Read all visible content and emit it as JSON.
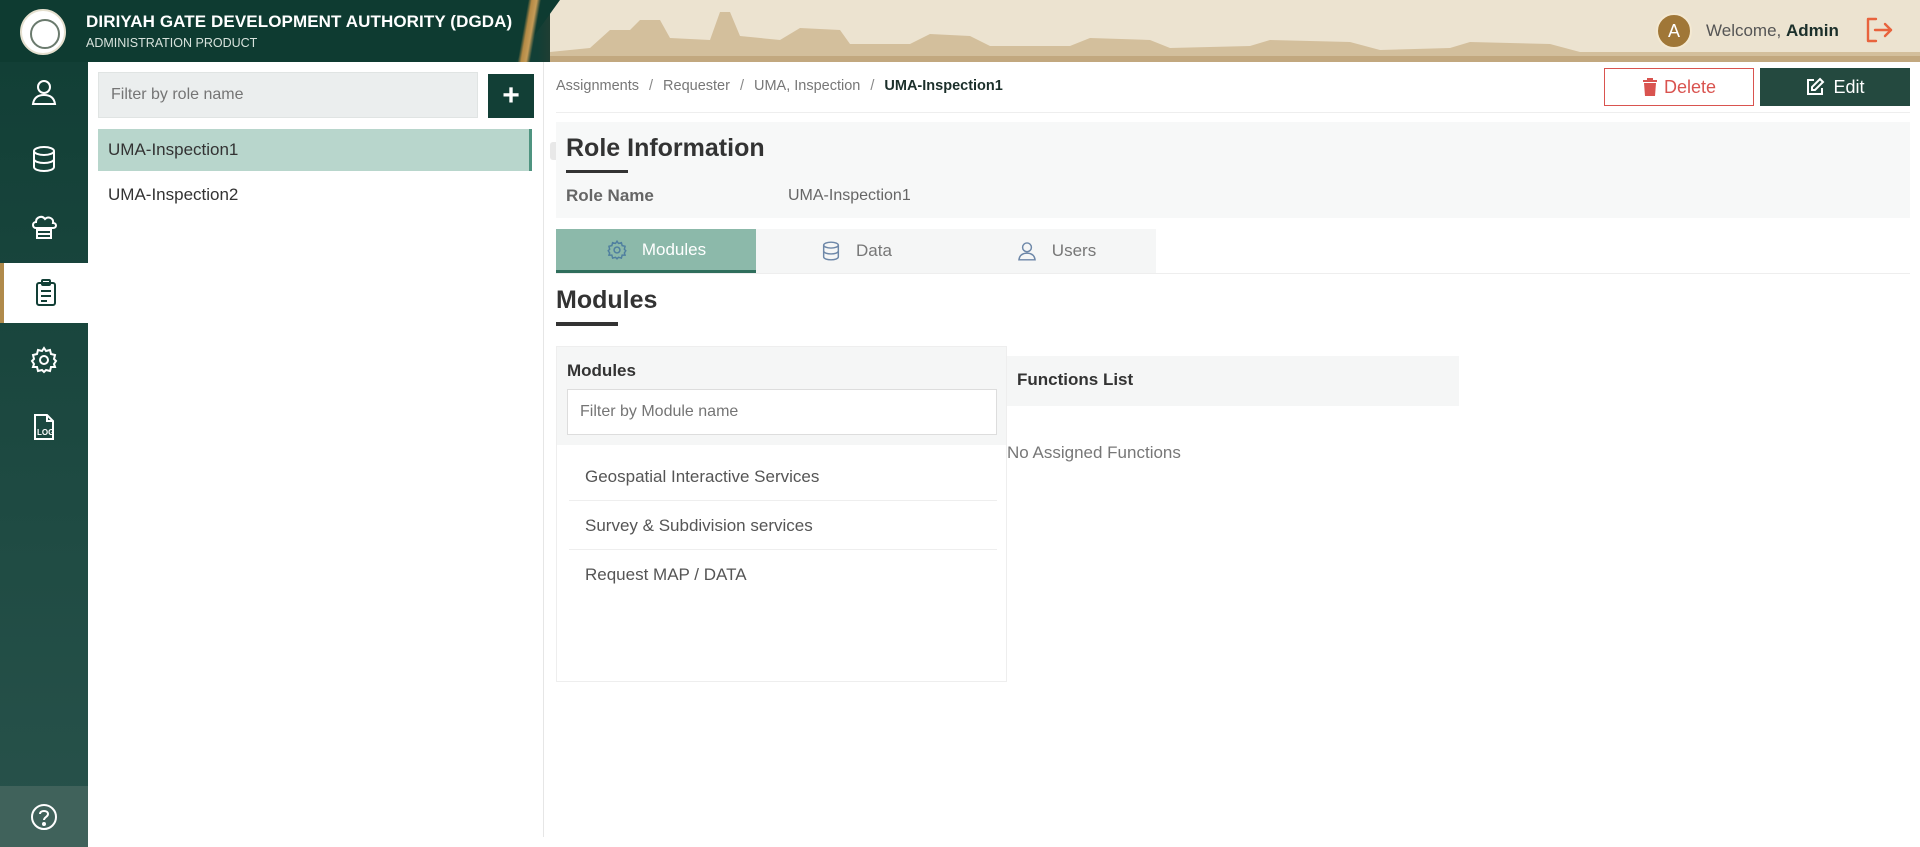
{
  "header": {
    "org_title": "DIRIYAH GATE DEVELOPMENT AUTHORITY (DGDA)",
    "org_subtitle": "ADMINISTRATION PRODUCT",
    "avatar_initial": "A",
    "welcome_text": "Welcome,",
    "user_name": "Admin"
  },
  "nav": {
    "items": [
      "user-icon",
      "database-icon",
      "cloud-server-icon",
      "clipboard-icon",
      "gear-icon",
      "log-file-icon"
    ],
    "help": "help-icon"
  },
  "roles": {
    "filter_placeholder": "Filter by role name",
    "add_label": "+",
    "items": [
      "UMA-Inspection1",
      "UMA-Inspection2"
    ],
    "selected_index": 0
  },
  "breadcrumb": {
    "items": [
      "Assignments",
      "Requester",
      "UMA, Inspection"
    ],
    "current": "UMA-Inspection1",
    "separator": "/"
  },
  "actions": {
    "delete_label": "Delete",
    "edit_label": "Edit"
  },
  "role_info": {
    "title": "Role Information",
    "name_label": "Role Name",
    "name_value": "UMA-Inspection1"
  },
  "tabs": [
    {
      "label": "Modules",
      "icon": "gear-icon"
    },
    {
      "label": "Data",
      "icon": "database-icon"
    },
    {
      "label": "Users",
      "icon": "user-icon"
    }
  ],
  "modules": {
    "heading": "Modules",
    "box_title": "Modules",
    "filter_placeholder": "Filter by Module name",
    "items": [
      "Geospatial Interactive Services",
      "Survey & Subdivision services",
      "Request MAP / DATA"
    ]
  },
  "functions": {
    "title": "Functions List",
    "empty_text": "No Assigned Functions"
  },
  "colors": {
    "primary_dark": "#123f36",
    "accent_gold": "#b08a4b",
    "tab_active": "#8cb9aa",
    "delete_red": "#d9534f"
  }
}
